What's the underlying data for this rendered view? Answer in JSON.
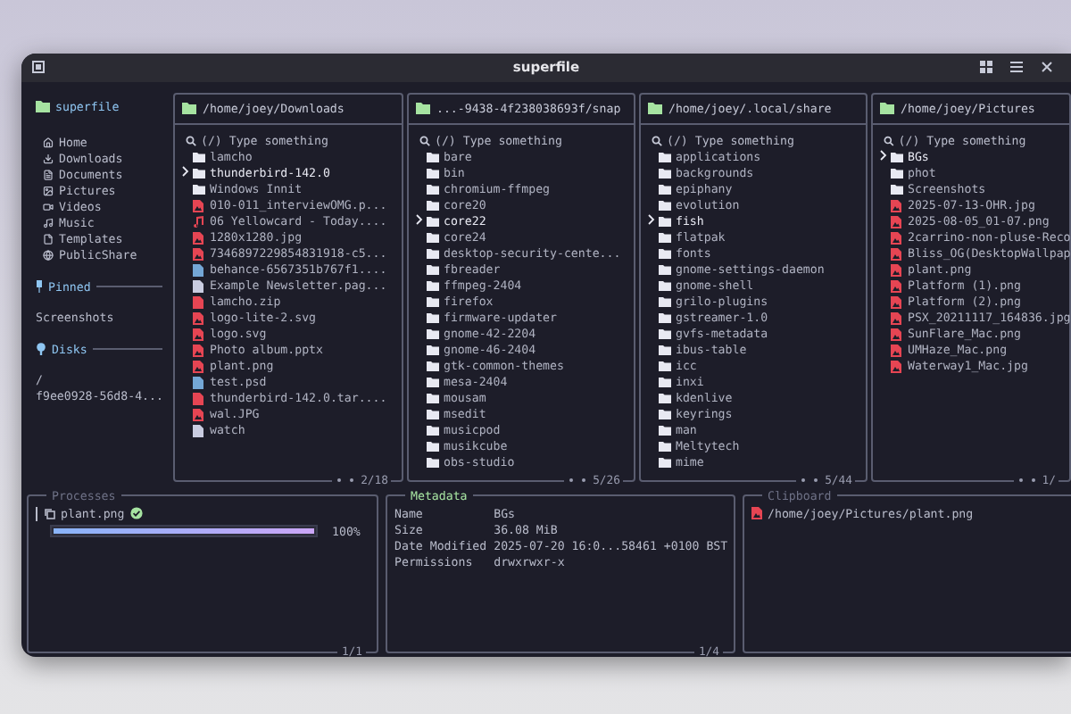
{
  "window": {
    "title": "superfile"
  },
  "sidebar": {
    "title": "superfile",
    "items": [
      {
        "label": "Home",
        "kind": "home"
      },
      {
        "label": "Downloads",
        "kind": "download"
      },
      {
        "label": "Documents",
        "kind": "doc"
      },
      {
        "label": "Pictures",
        "kind": "picture"
      },
      {
        "label": "Videos",
        "kind": "video"
      },
      {
        "label": "Music",
        "kind": "music"
      },
      {
        "label": "Templates",
        "kind": "template"
      },
      {
        "label": "PublicShare",
        "kind": "globe"
      }
    ],
    "pinned": {
      "title": "Pinned",
      "items": [
        "Screenshots"
      ]
    },
    "disks": {
      "title": "Disks",
      "items": [
        "/",
        "f9ee0928-56d8-4..."
      ]
    }
  },
  "panels": [
    {
      "path": "/home/joey/Downloads",
      "search": {
        "placeholder": "(/) Type something"
      },
      "position": "2/18",
      "files": [
        {
          "name": "lamcho",
          "kind": "folder",
          "selected": false
        },
        {
          "name": "thunderbird-142.0",
          "kind": "folder",
          "selected": true
        },
        {
          "name": "Windows Innit",
          "kind": "folder",
          "selected": false
        },
        {
          "name": "010-011_interviewOMG.p...",
          "kind": "image",
          "selected": false
        },
        {
          "name": "06 Yellowcard - Today....",
          "kind": "audio",
          "selected": false
        },
        {
          "name": "1280x1280.jpg",
          "kind": "image",
          "selected": false
        },
        {
          "name": "7346897229854831918-c5...",
          "kind": "image",
          "selected": false
        },
        {
          "name": "behance-6567351b767f1....",
          "kind": "design",
          "selected": false
        },
        {
          "name": "Example Newsletter.pag...",
          "kind": "doc",
          "selected": false
        },
        {
          "name": "lamcho.zip",
          "kind": "archive",
          "selected": false
        },
        {
          "name": "logo-lite-2.svg",
          "kind": "image",
          "selected": false
        },
        {
          "name": "logo.svg",
          "kind": "image",
          "selected": false
        },
        {
          "name": "Photo album.pptx",
          "kind": "image",
          "selected": false
        },
        {
          "name": "plant.png",
          "kind": "image",
          "selected": false
        },
        {
          "name": "test.psd",
          "kind": "design",
          "selected": false
        },
        {
          "name": "thunderbird-142.0.tar....",
          "kind": "archive",
          "selected": false
        },
        {
          "name": "wal.JPG",
          "kind": "image",
          "selected": false
        },
        {
          "name": "watch",
          "kind": "doc",
          "selected": false
        }
      ]
    },
    {
      "path": "...-9438-4f238038693f/snap",
      "search": {
        "placeholder": "(/) Type something"
      },
      "position": "5/26",
      "files": [
        {
          "name": "bare",
          "kind": "folder",
          "selected": false
        },
        {
          "name": "bin",
          "kind": "folder",
          "selected": false
        },
        {
          "name": "chromium-ffmpeg",
          "kind": "folder",
          "selected": false
        },
        {
          "name": "core20",
          "kind": "folder",
          "selected": false
        },
        {
          "name": "core22",
          "kind": "folder",
          "selected": true
        },
        {
          "name": "core24",
          "kind": "folder",
          "selected": false
        },
        {
          "name": "desktop-security-cente...",
          "kind": "folder",
          "selected": false
        },
        {
          "name": "fbreader",
          "kind": "folder",
          "selected": false
        },
        {
          "name": "ffmpeg-2404",
          "kind": "folder",
          "selected": false
        },
        {
          "name": "firefox",
          "kind": "folder",
          "selected": false
        },
        {
          "name": "firmware-updater",
          "kind": "folder",
          "selected": false
        },
        {
          "name": "gnome-42-2204",
          "kind": "folder",
          "selected": false
        },
        {
          "name": "gnome-46-2404",
          "kind": "folder",
          "selected": false
        },
        {
          "name": "gtk-common-themes",
          "kind": "folder",
          "selected": false
        },
        {
          "name": "mesa-2404",
          "kind": "folder",
          "selected": false
        },
        {
          "name": "mousam",
          "kind": "folder",
          "selected": false
        },
        {
          "name": "msedit",
          "kind": "folder",
          "selected": false
        },
        {
          "name": "musicpod",
          "kind": "folder",
          "selected": false
        },
        {
          "name": "musikcube",
          "kind": "folder",
          "selected": false
        },
        {
          "name": "obs-studio",
          "kind": "folder",
          "selected": false
        }
      ]
    },
    {
      "path": "/home/joey/.local/share",
      "search": {
        "placeholder": "(/) Type something"
      },
      "position": "5/44",
      "files": [
        {
          "name": "applications",
          "kind": "folder",
          "selected": false
        },
        {
          "name": "backgrounds",
          "kind": "folder",
          "selected": false
        },
        {
          "name": "epiphany",
          "kind": "folder",
          "selected": false
        },
        {
          "name": "evolution",
          "kind": "folder",
          "selected": false
        },
        {
          "name": "fish",
          "kind": "folder",
          "selected": true
        },
        {
          "name": "flatpak",
          "kind": "folder",
          "selected": false
        },
        {
          "name": "fonts",
          "kind": "folder",
          "selected": false
        },
        {
          "name": "gnome-settings-daemon",
          "kind": "folder",
          "selected": false
        },
        {
          "name": "gnome-shell",
          "kind": "folder",
          "selected": false
        },
        {
          "name": "grilo-plugins",
          "kind": "folder",
          "selected": false
        },
        {
          "name": "gstreamer-1.0",
          "kind": "folder",
          "selected": false
        },
        {
          "name": "gvfs-metadata",
          "kind": "folder",
          "selected": false
        },
        {
          "name": "ibus-table",
          "kind": "folder",
          "selected": false
        },
        {
          "name": "icc",
          "kind": "folder",
          "selected": false
        },
        {
          "name": "inxi",
          "kind": "folder",
          "selected": false
        },
        {
          "name": "kdenlive",
          "kind": "folder",
          "selected": false
        },
        {
          "name": "keyrings",
          "kind": "folder",
          "selected": false
        },
        {
          "name": "man",
          "kind": "folder",
          "selected": false
        },
        {
          "name": "Meltytech",
          "kind": "folder",
          "selected": false
        },
        {
          "name": "mime",
          "kind": "folder",
          "selected": false
        }
      ]
    },
    {
      "path": "/home/joey/Pictures",
      "search": {
        "placeholder": "(/) Type something"
      },
      "position": "1/",
      "files": [
        {
          "name": "BGs",
          "kind": "folder",
          "selected": true
        },
        {
          "name": "phot",
          "kind": "folder",
          "selected": false
        },
        {
          "name": "Screenshots",
          "kind": "folder",
          "selected": false
        },
        {
          "name": "2025-07-13-OHR.jpg",
          "kind": "image",
          "selected": false
        },
        {
          "name": "2025-08-05_01-07.png",
          "kind": "image",
          "selected": false
        },
        {
          "name": "2carrino-non-pluse-Reco",
          "kind": "image",
          "selected": false
        },
        {
          "name": "Bliss_OG(DesktopWallpap",
          "kind": "image",
          "selected": false
        },
        {
          "name": "plant.png",
          "kind": "image",
          "selected": false
        },
        {
          "name": "Platform (1).png",
          "kind": "image",
          "selected": false
        },
        {
          "name": "Platform (2).png",
          "kind": "image",
          "selected": false
        },
        {
          "name": "PSX_20211117_164836.jpg",
          "kind": "image",
          "selected": false
        },
        {
          "name": "SunFlare_Mac.png",
          "kind": "image",
          "selected": false
        },
        {
          "name": "UMHaze_Mac.png",
          "kind": "image",
          "selected": false
        },
        {
          "name": "Waterway1_Mac.jpg",
          "kind": "image",
          "selected": false
        }
      ]
    }
  ],
  "processes": {
    "title": "Processes",
    "position": "1/1",
    "items": [
      {
        "name": "plant.png",
        "level": 1,
        "reading": "100%",
        "done": true
      }
    ]
  },
  "metadata": {
    "title": "Metadata",
    "position": "1/4",
    "rows": [
      {
        "label": "Name",
        "value": "BGs"
      },
      {
        "label": "Size",
        "value": "36.08 MiB"
      },
      {
        "label": "Date Modified",
        "value": "2025-07-20 16:0...58461 +0100 BST"
      },
      {
        "label": "Permissions",
        "value": "drwxrwxr-x"
      }
    ]
  },
  "clipboard": {
    "title": "Clipboard",
    "items": [
      "/home/joey/Pictures/plant.png"
    ]
  }
}
